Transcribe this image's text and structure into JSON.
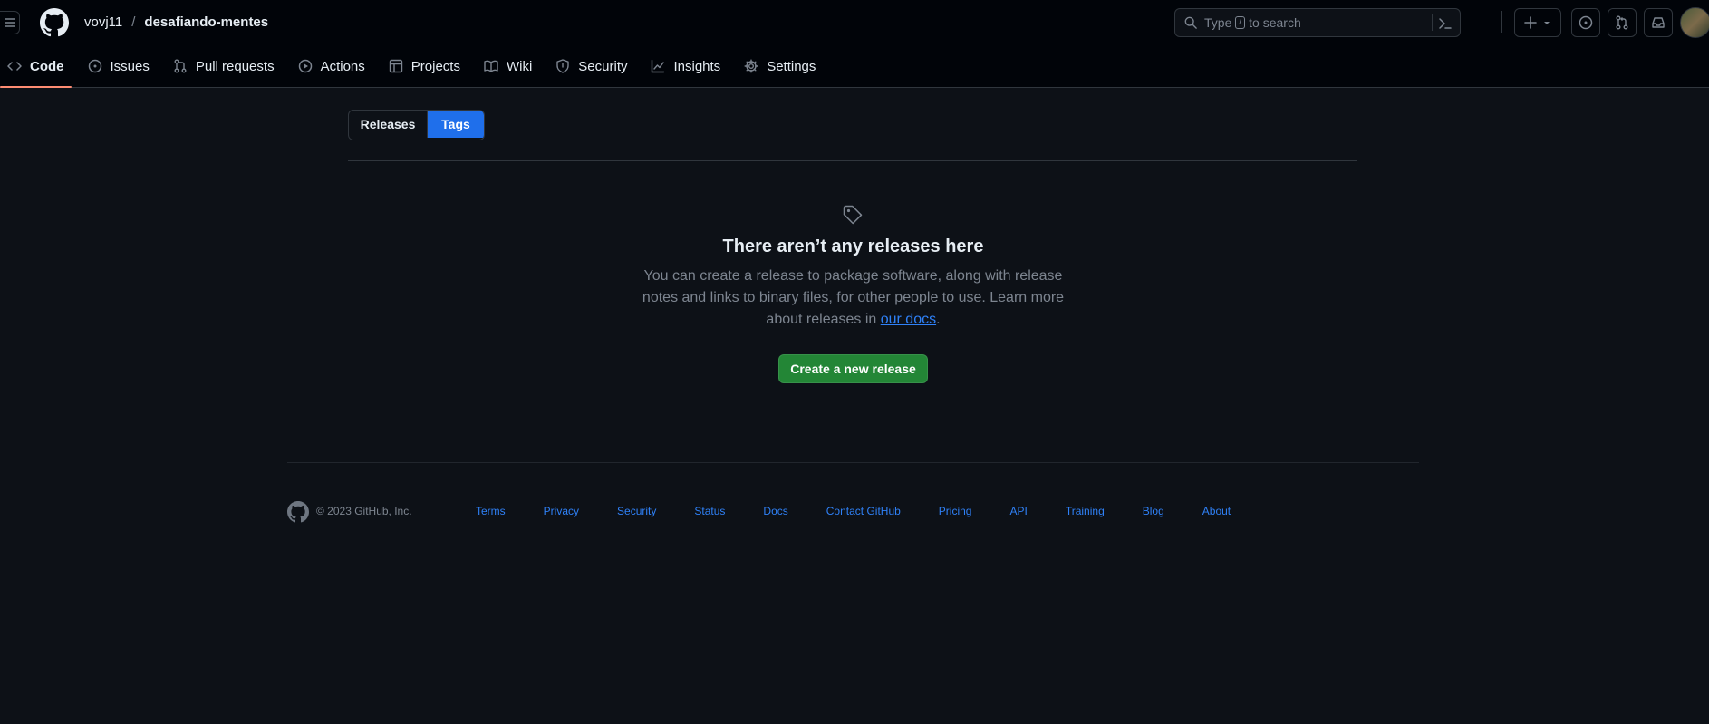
{
  "header": {
    "owner": "vovj11",
    "separator": "/",
    "repo": "desafiando-mentes",
    "search": {
      "prefix": "Type",
      "key": "/",
      "suffix": "to search"
    }
  },
  "nav": {
    "tabs": [
      {
        "label": "Code",
        "icon": "code-icon",
        "active": true
      },
      {
        "label": "Issues",
        "icon": "issue-opened-icon"
      },
      {
        "label": "Pull requests",
        "icon": "git-pull-request-icon"
      },
      {
        "label": "Actions",
        "icon": "play-icon"
      },
      {
        "label": "Projects",
        "icon": "table-icon"
      },
      {
        "label": "Wiki",
        "icon": "book-icon"
      },
      {
        "label": "Security",
        "icon": "shield-icon"
      },
      {
        "label": "Insights",
        "icon": "graph-icon"
      },
      {
        "label": "Settings",
        "icon": "gear-icon"
      }
    ]
  },
  "subnav": {
    "releases": "Releases",
    "tags": "Tags",
    "selected": "Tags"
  },
  "blankslate": {
    "title": "There aren’t any releases here",
    "description": "You can create a release to package software, along with release notes and links to binary files, for other people to use. Learn more about releases in ",
    "link": "our docs",
    "end": ".",
    "button": "Create a new release"
  },
  "footer": {
    "copyright": "© 2023 GitHub, Inc.",
    "links": [
      "Terms",
      "Privacy",
      "Security",
      "Status",
      "Docs",
      "Contact GitHub",
      "Pricing",
      "API",
      "Training",
      "Blog",
      "About"
    ]
  },
  "colors": {
    "background": "#0d1117",
    "header_bg": "#010409",
    "accent_blue": "#1f6feb",
    "link_blue": "#2f81f7",
    "primary_green": "#238636",
    "active_underline": "#fd8c73",
    "muted_text": "#7d8590"
  }
}
